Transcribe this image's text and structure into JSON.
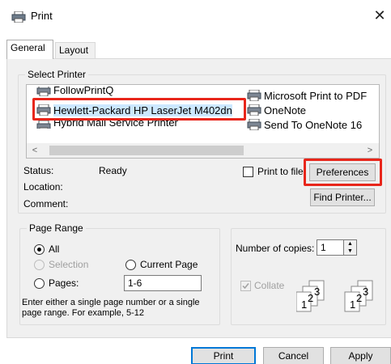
{
  "window": {
    "title": "Print",
    "close_glyph": "✕"
  },
  "tabs": [
    {
      "label": "General",
      "active": true
    },
    {
      "label": "Layout",
      "active": false
    }
  ],
  "select_printer": {
    "group_label": "Select Printer",
    "printers": [
      {
        "name": "FollowPrintQ"
      },
      {
        "name": "Hewlett-Packard HP LaserJet M402dn",
        "selected": true
      },
      {
        "name": "Hybrid Mail Service Printer"
      },
      {
        "name": "Microsoft Print to PDF"
      },
      {
        "name": "OneNote"
      },
      {
        "name": "Send To OneNote 16"
      }
    ],
    "scroll_left": "<",
    "scroll_right": ">",
    "status_label": "Status:",
    "status_value": "Ready",
    "location_label": "Location:",
    "comment_label": "Comment:",
    "print_to_file_label": "Print to file",
    "preferences_button": "Preferences",
    "find_printer_button": "Find Printer..."
  },
  "page_range": {
    "group_label": "Page Range",
    "all_label": "All",
    "selection_label": "Selection",
    "current_page_label": "Current Page",
    "pages_label": "Pages:",
    "pages_value": "1-6",
    "hint_line1": "Enter either a single page number or a single",
    "hint_line2": "page range.  For example, 5-12"
  },
  "copies": {
    "number_label": "Number of copies:",
    "number_value": "1",
    "collate_label": "Collate",
    "collate_page_numbers": [
      "1",
      "2",
      "3"
    ]
  },
  "footer": {
    "print_button": "Print",
    "cancel_button": "Cancel",
    "apply_button": "Apply"
  },
  "colors": {
    "highlight": "#e8261b",
    "selection": "#cce8ff",
    "accent": "#0078d7"
  }
}
